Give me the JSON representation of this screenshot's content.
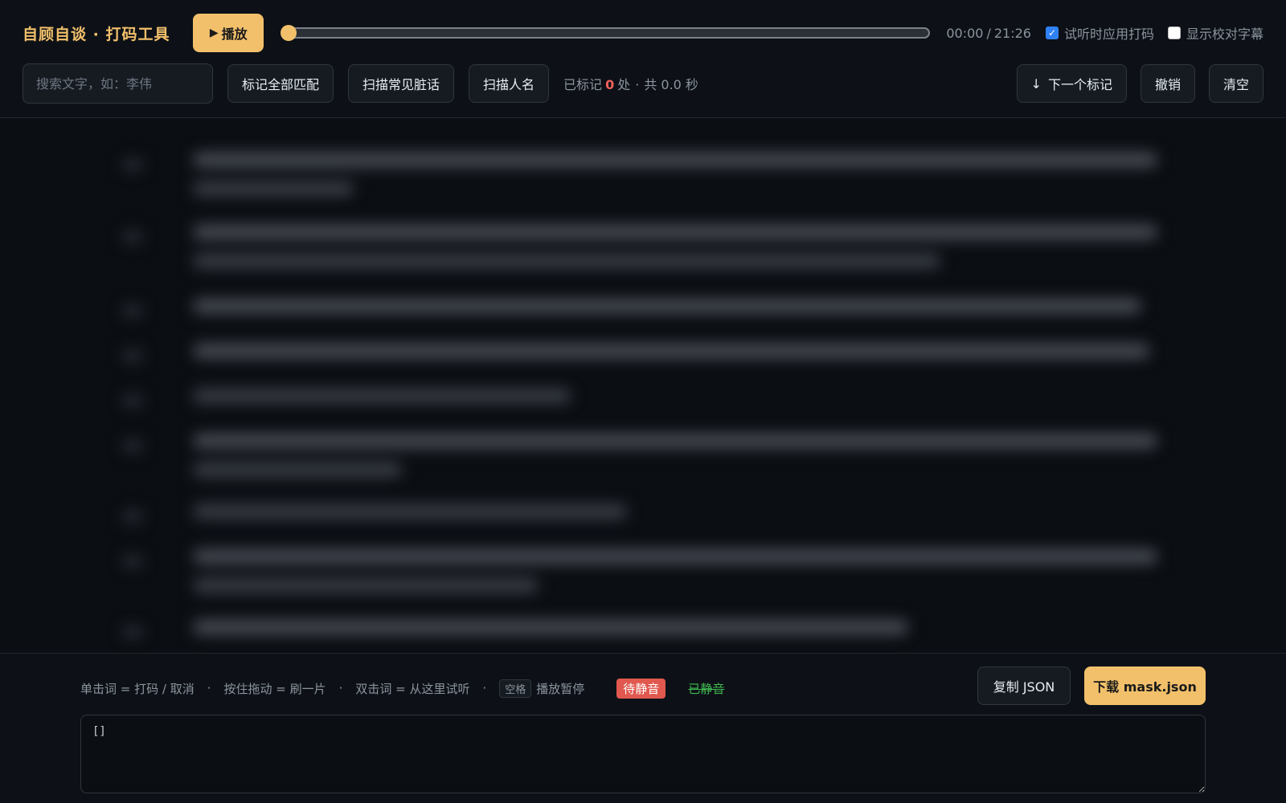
{
  "header": {
    "title": "自顾自谈 · 打码工具",
    "play_label": "播放",
    "play_icon": "▶",
    "time_current": "00:00",
    "time_separator": "/",
    "time_total": "21:26",
    "progress": 0,
    "apply_mask_label": "试听时应用打码",
    "apply_mask_checked": true,
    "show_subs_label": "显示校对字幕",
    "show_subs_checked": false
  },
  "toolbar": {
    "search_placeholder": "搜索文字，如：李伟",
    "mark_all_label": "标记全部匹配",
    "scan_dirty_label": "扫描常见脏话",
    "scan_names_label": "扫描人名",
    "stats_prefix": "已标记",
    "stats_count": "0",
    "stats_suffix": "处",
    "stats_dot": "·",
    "stats_total": "共 0.0 秒",
    "next_icon": "↓",
    "next_label": "下一个标记",
    "undo_label": "撤销",
    "clear_label": "清空"
  },
  "footer": {
    "hint_click": "单击词 = 打码 / 取消",
    "hint_drag": "按住拖动 = 刷一片",
    "hint_dblclick": "双击词 = 从这里试听",
    "hint_dot": "·",
    "key_space": "空格",
    "hint_space": "播放暂停",
    "badge_pending": "待静音",
    "badge_done": "已静音",
    "copy_json_label": "复制 JSON",
    "download_label": "下载 mask.json",
    "json_value": "[]"
  },
  "colors": {
    "accent": "#f2c06b",
    "background": "#0d1117",
    "pending_badge": "#e0584e",
    "done_text": "#3fb950",
    "count_red": "#f0615a",
    "checkbox_blue": "#2f81f7"
  }
}
